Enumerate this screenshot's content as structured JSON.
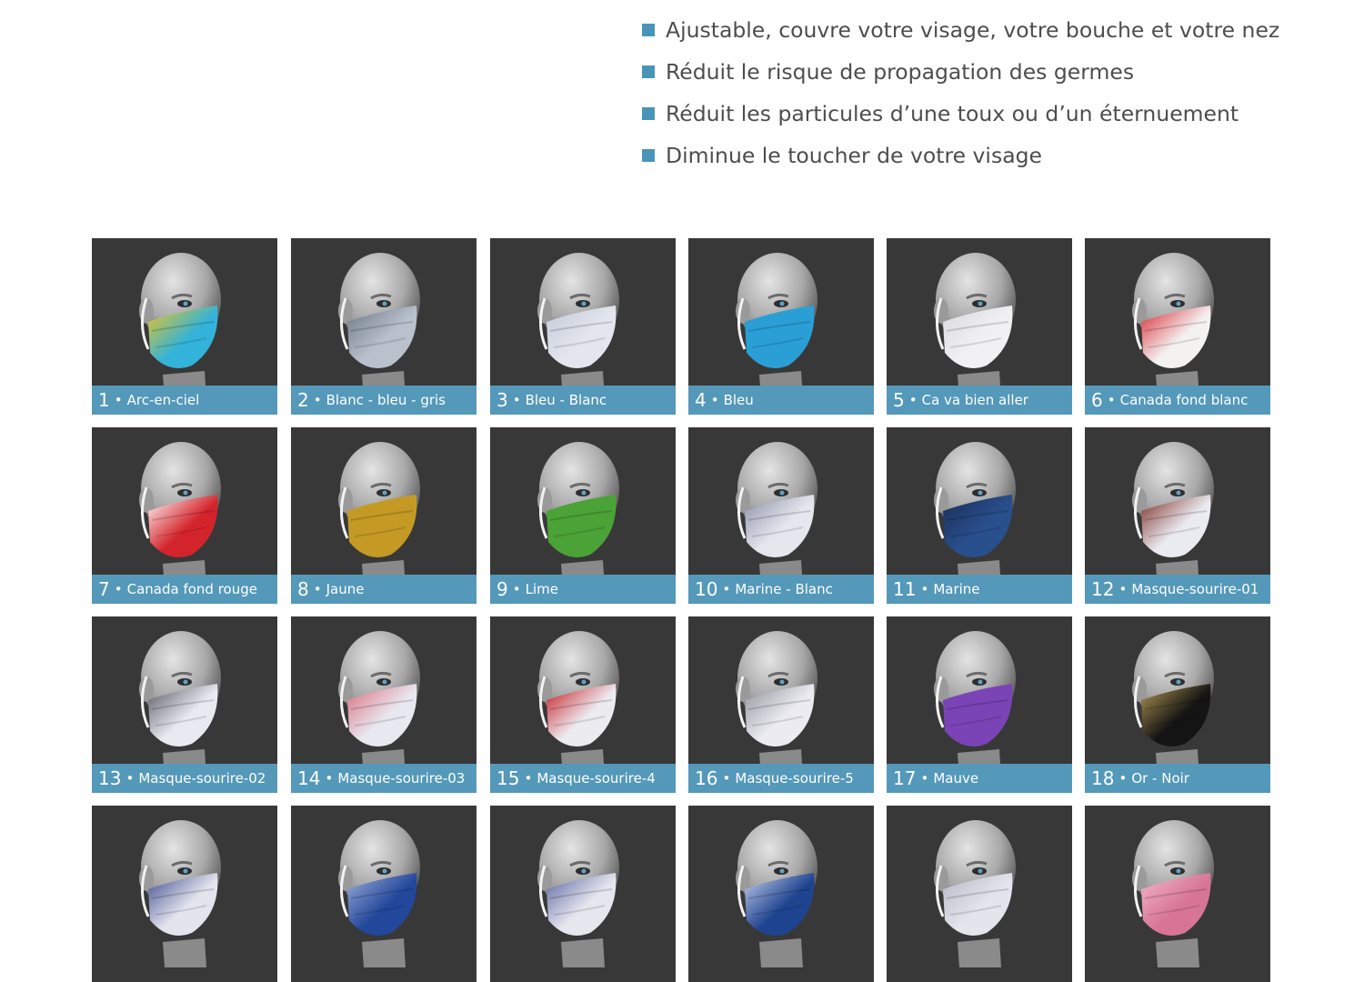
{
  "features": [
    "Ajustable, couvre votre visage, votre bouche et votre nez",
    "Réduit le risque de propagation des germes",
    "Réduit les particules d’une toux ou d’un éternuement",
    "Diminue le toucher de votre visage"
  ],
  "colors": {
    "accent": "#5498ba",
    "bullet": "#4a95b7",
    "card_bg": "#383838"
  },
  "masks": [
    {
      "number": "1",
      "name": "Arc-en-ciel",
      "color": "#33b3d9",
      "color2": "#f2c51c"
    },
    {
      "number": "2",
      "name": "Blanc - bleu - gris",
      "color": "#b9c1cc",
      "color2": "#6c7686"
    },
    {
      "number": "3",
      "name": "Bleu - Blanc",
      "color": "#e3e6ee",
      "color2": "#c4c9d8"
    },
    {
      "number": "4",
      "name": "Bleu",
      "color": "#2a9fd6",
      "color2": "#2a9fd6"
    },
    {
      "number": "5",
      "name": "Ca va bien aller",
      "color": "#f1f1f3",
      "color2": "#d8d8de"
    },
    {
      "number": "6",
      "name": "Canada fond blanc",
      "color": "#f4f1f1",
      "color2": "#d7262e"
    },
    {
      "number": "7",
      "name": "Canada fond rouge",
      "color": "#d4242b",
      "color2": "#ffffff"
    },
    {
      "number": "8",
      "name": "Jaune",
      "color": "#c49a24",
      "color2": "#c49a24"
    },
    {
      "number": "9",
      "name": "Lime",
      "color": "#4ba236",
      "color2": "#4ba236"
    },
    {
      "number": "10",
      "name": "Marine - Blanc",
      "color": "#e6e7ee",
      "color2": "#8a90a8"
    },
    {
      "number": "11",
      "name": "Marine",
      "color": "#294f8c",
      "color2": "#1b2d56"
    },
    {
      "number": "12",
      "name": "Masque-sourire-01",
      "color": "#eaeaf1",
      "color2": "#7a2a1e"
    },
    {
      "number": "13",
      "name": "Masque-sourire-02",
      "color": "#e9e9f1",
      "color2": "#555560"
    },
    {
      "number": "14",
      "name": "Masque-sourire-03",
      "color": "#e8e8f0",
      "color2": "#d96a7a"
    },
    {
      "number": "15",
      "name": "Masque-sourire-4",
      "color": "#ecebf0",
      "color2": "#c4161c"
    },
    {
      "number": "16",
      "name": "Masque-sourire-5",
      "color": "#ebebf1",
      "color2": "#8f8f99"
    },
    {
      "number": "17",
      "name": "Mauve",
      "color": "#7a44b6",
      "color2": "#7a44b6"
    },
    {
      "number": "18",
      "name": "Or - Noir",
      "color": "#141414",
      "color2": "#b79a53"
    },
    {
      "color": "#e3e4ee",
      "color2": "#3c4a8c"
    },
    {
      "color": "#23479a",
      "color2": "#9fb0da"
    },
    {
      "color": "#e5e6ee",
      "color2": "#5a63a0"
    },
    {
      "color": "#1f448f",
      "color2": "#c9d2ee"
    },
    {
      "color": "#e3e4ec",
      "color2": "#b5b7c4"
    },
    {
      "color": "#d77597",
      "color2": "#f3b6ca"
    }
  ]
}
